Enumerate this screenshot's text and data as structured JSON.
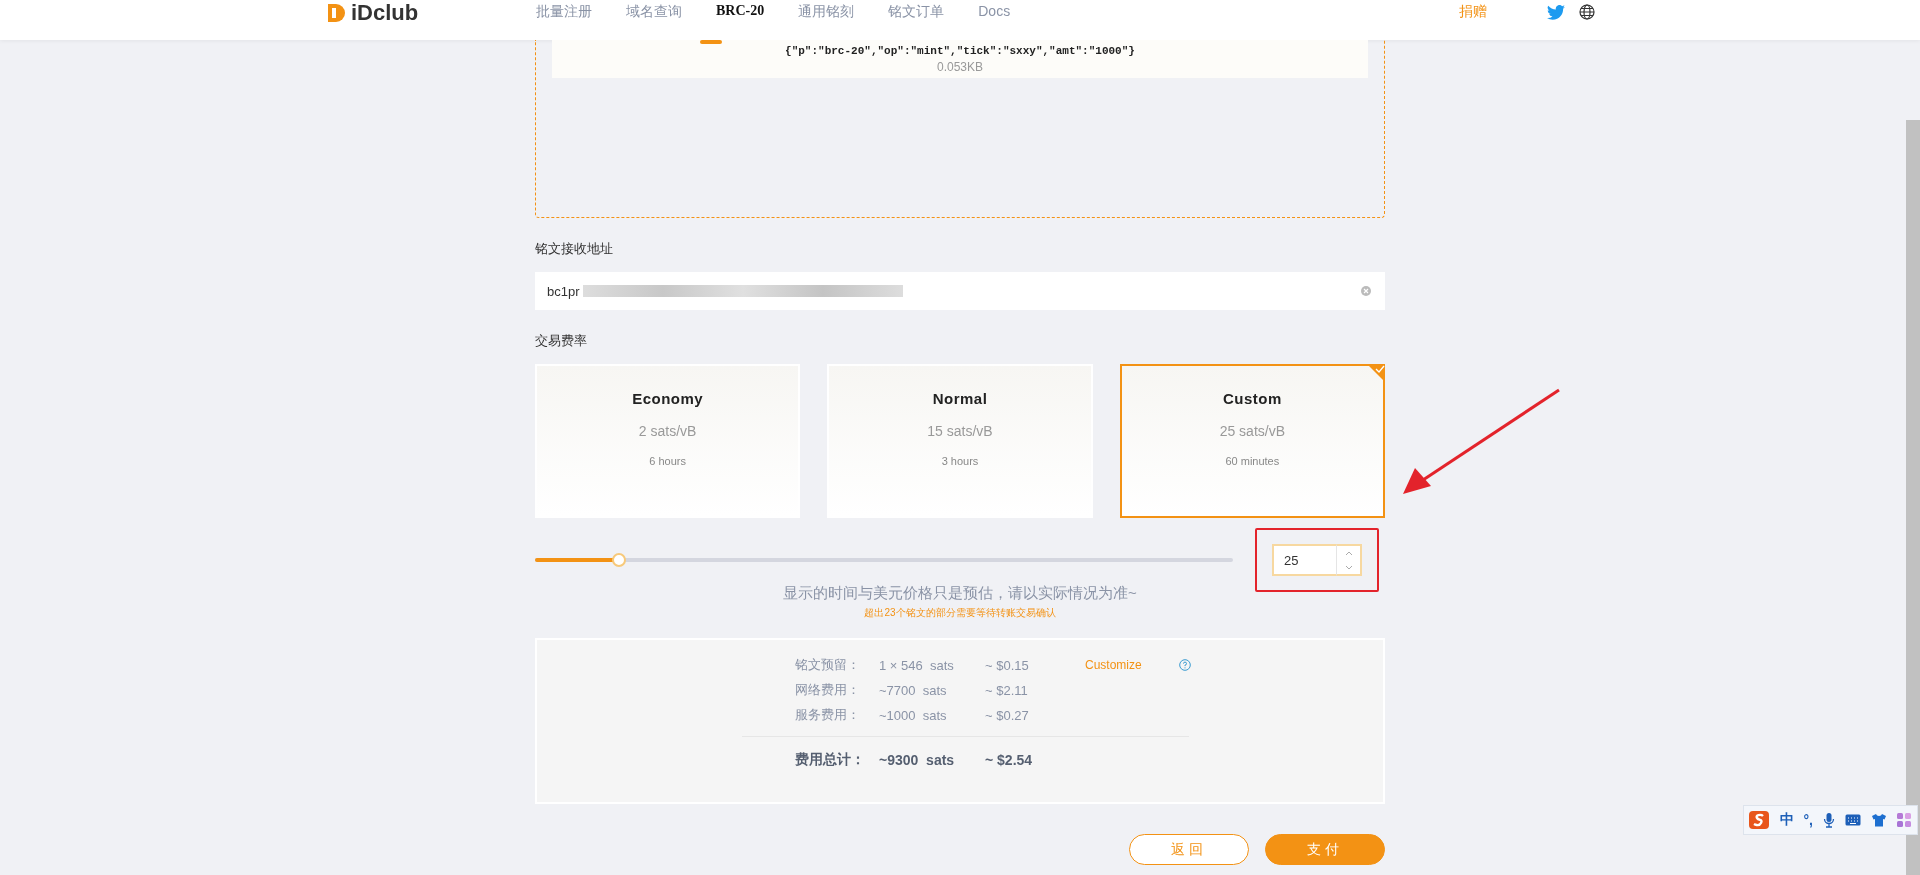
{
  "header": {
    "logo": "iDclub",
    "nav": [
      {
        "label": "批量注册",
        "selected": false
      },
      {
        "label": "域名查询",
        "selected": false
      },
      {
        "label": "BRC-20",
        "selected": true
      },
      {
        "label": "通用铭刻",
        "selected": false
      },
      {
        "label": "铭文订单",
        "selected": false
      },
      {
        "label": "Docs",
        "selected": false
      }
    ],
    "donate": "捐赠"
  },
  "inscription": {
    "content": "{\"p\":\"brc-20\",\"op\":\"mint\",\"tick\":\"sxxy\",\"amt\":\"1000\"}",
    "size": "0.053KB"
  },
  "address": {
    "label": "铭文接收地址",
    "value": "bc1pr"
  },
  "fee": {
    "label": "交易费率",
    "options": [
      {
        "name": "Economy",
        "rate": "2 sats/vB",
        "time": "6 hours",
        "selected": false
      },
      {
        "name": "Normal",
        "rate": "15 sats/vB",
        "time": "3 hours",
        "selected": false
      },
      {
        "name": "Custom",
        "rate": "25 sats/vB",
        "time": "60 minutes",
        "selected": true
      }
    ],
    "slider": {
      "level": 0.12
    },
    "custom_value": "25"
  },
  "notes": {
    "info": "显示的时间与美元价格只是预估，请以实际情况为准~",
    "warning": "超出23个铭文的部分需要等待转账交易确认"
  },
  "summary": {
    "rows": [
      {
        "label": "铭文预留：",
        "amount": "1 × 546  sats",
        "usd": "~ $0.15"
      },
      {
        "label": "网络费用：",
        "amount": "~7700  sats",
        "usd": "~ $2.11"
      },
      {
        "label": "服务费用：",
        "amount": "~1000  sats",
        "usd": "~ $0.27"
      }
    ],
    "customize": "Customize",
    "total": {
      "label": "费用总计：",
      "amount": "~9300  sats",
      "usd": "~ $2.54"
    }
  },
  "buttons": [
    {
      "label": "返回",
      "kind": "secondary"
    },
    {
      "label": "支付",
      "kind": "primary"
    }
  ],
  "ime_toolbar": {
    "items": [
      "中",
      "°,"
    ]
  }
}
